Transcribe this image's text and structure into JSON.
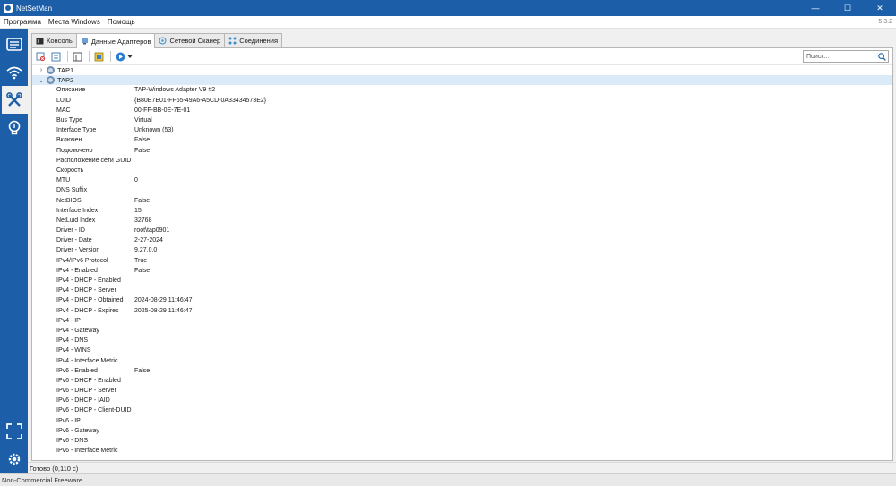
{
  "window": {
    "title": "NetSetMan",
    "minimize": "—",
    "maximize": "☐",
    "close": "✕"
  },
  "menu": {
    "items": [
      "Программа",
      "Места Windows",
      "Помощь"
    ],
    "version": "5.3.2"
  },
  "sidebar": {
    "icons": [
      "list-icon",
      "wifi-icon",
      "tools-icon",
      "lightbulb-icon",
      "fullscreen-icon",
      "settings-icon"
    ],
    "active": "tools-icon"
  },
  "tabs": [
    {
      "label": "Консоль",
      "icon": "console-icon"
    },
    {
      "label": "Данные Адаптеров",
      "icon": "adapter-icon",
      "active": true
    },
    {
      "label": "Сетевой Сканер",
      "icon": "scanner-icon"
    },
    {
      "label": "Соединения",
      "icon": "connections-icon"
    }
  ],
  "search": {
    "placeholder": "Поиск..."
  },
  "tree": {
    "nodes": [
      {
        "label": "TAP1",
        "expanded": false
      },
      {
        "label": "TAP2",
        "expanded": true
      }
    ],
    "properties": [
      {
        "k": "Описание",
        "v": "TAP-Windows Adapter V9 #2"
      },
      {
        "k": "LUID",
        "v": "{B80E7E01-FF65-49A6-A5CD-0A33434573E2}"
      },
      {
        "k": "MAC",
        "v": "00-FF-BB-0E-7E-01"
      },
      {
        "k": "Bus Type",
        "v": "Virtual"
      },
      {
        "k": "Interface Type",
        "v": "Unknown (53)"
      },
      {
        "k": "Включен",
        "v": "False"
      },
      {
        "k": "Подключено",
        "v": "False"
      },
      {
        "k": "Расположение сети GUID",
        "v": ""
      },
      {
        "k": "Скорость",
        "v": ""
      },
      {
        "k": "MTU",
        "v": "0"
      },
      {
        "k": "DNS Suffix",
        "v": ""
      },
      {
        "k": "NetBIOS",
        "v": "False"
      },
      {
        "k": "Interface Index",
        "v": "15"
      },
      {
        "k": "NetLuid Index",
        "v": "32768"
      },
      {
        "k": "Driver - ID",
        "v": "root\\tap0901"
      },
      {
        "k": "Driver - Date",
        "v": "2-27-2024"
      },
      {
        "k": "Driver - Version",
        "v": "9.27.0.0"
      },
      {
        "k": "IPv4/IPv6 Protocol",
        "v": "True"
      },
      {
        "k": "IPv4 - Enabled",
        "v": "False"
      },
      {
        "k": "IPv4 - DHCP - Enabled",
        "v": ""
      },
      {
        "k": "IPv4 - DHCP - Server",
        "v": ""
      },
      {
        "k": "IPv4 - DHCP - Obtained",
        "v": "2024-08-29 11:46:47"
      },
      {
        "k": "IPv4 - DHCP - Expires",
        "v": "2025-08-29 11:46:47"
      },
      {
        "k": "IPv4 - IP",
        "v": ""
      },
      {
        "k": "IPv4 - Gateway",
        "v": ""
      },
      {
        "k": "IPv4 - DNS",
        "v": ""
      },
      {
        "k": "IPv4 - WINS",
        "v": ""
      },
      {
        "k": "IPv4 - Interface Metric",
        "v": ""
      },
      {
        "k": "IPv6 - Enabled",
        "v": "False"
      },
      {
        "k": "IPv6 - DHCP - Enabled",
        "v": ""
      },
      {
        "k": "IPv6 - DHCP - Server",
        "v": ""
      },
      {
        "k": "IPv6 - DHCP - IAID",
        "v": ""
      },
      {
        "k": "IPv6 - DHCP - Client-DUID",
        "v": ""
      },
      {
        "k": "IPv6 - IP",
        "v": ""
      },
      {
        "k": "IPv6 - Gateway",
        "v": ""
      },
      {
        "k": "IPv6 - DNS",
        "v": ""
      },
      {
        "k": "IPv6 - Interface Metric",
        "v": ""
      }
    ]
  },
  "status": {
    "text": "Готово (0,110 с)"
  },
  "bottom": {
    "text": "Non-Commercial Freeware"
  },
  "colors": {
    "accent": "#1c5fa8",
    "selection": "#dbeaf8"
  }
}
